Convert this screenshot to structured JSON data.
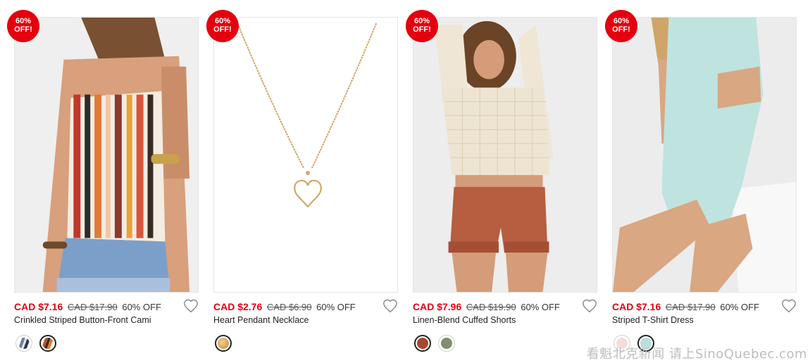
{
  "products": [
    {
      "badge_line1": "60%",
      "badge_line2": "OFF!",
      "sale_price": "CAD $7.16",
      "original_price": "CAD $17.90",
      "discount": "60% OFF",
      "name": "Crinkled Striped Button-Front Cami",
      "image_icon": "striped-cami-photo",
      "swatches": [
        {
          "color": "#6e7f99",
          "selected": false
        },
        {
          "color": "#b5532c",
          "selected": true
        }
      ]
    },
    {
      "badge_line1": "60%",
      "badge_line2": "OFF!",
      "sale_price": "CAD $2.76",
      "original_price": "CAD $6.90",
      "discount": "60% OFF",
      "name": "Heart Pendant Necklace",
      "image_icon": "heart-necklace-photo",
      "swatches": [
        {
          "color": "#d9a25a",
          "selected": true
        }
      ]
    },
    {
      "badge_line1": "60%",
      "badge_line2": "OFF!",
      "sale_price": "CAD $7.96",
      "original_price": "CAD $19.90",
      "discount": "60% OFF",
      "name": "Linen-Blend Cuffed Shorts",
      "image_icon": "cuffed-shorts-photo",
      "swatches": [
        {
          "color": "#a8482e",
          "selected": true
        },
        {
          "color": "#7f8f6c",
          "selected": false
        }
      ]
    },
    {
      "badge_line1": "60%",
      "badge_line2": "OFF!",
      "sale_price": "CAD $7.16",
      "original_price": "CAD $17.90",
      "discount": "60% OFF",
      "name": "Striped T-Shirt Dress",
      "image_icon": "tshirt-dress-photo",
      "swatches": [
        {
          "color": "#f7dcdc",
          "selected": false
        },
        {
          "color": "#b9dedb",
          "selected": true
        }
      ]
    }
  ],
  "colors": {
    "sale": "#e4000f",
    "badge": "#e4000f"
  },
  "watermark": "看魁北克新闻 请上SinoQuebec.com"
}
